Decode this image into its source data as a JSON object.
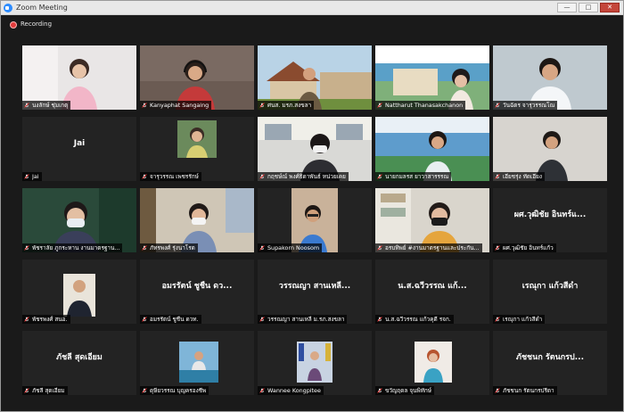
{
  "window": {
    "title": "Zoom Meeting",
    "controls": {
      "minimize": "—",
      "maximize": "□",
      "close": "✕"
    }
  },
  "recording": {
    "label": "Recording"
  },
  "participants": [
    {
      "name": "นงลักษ์ ชุ่มเกตุ",
      "display": "",
      "video": "woman-light"
    },
    {
      "name": "Kanyaphat Sangaing",
      "display": "",
      "video": "woman-headset"
    },
    {
      "name": "ศนส. มรภ.สงขลา",
      "display": "",
      "video": "building-man"
    },
    {
      "name": "Nattharut Thanasakchanon",
      "display": "",
      "video": "banner-woman"
    },
    {
      "name": "วันฉัตร จารุวรรณโณ",
      "display": "",
      "video": "man-smile",
      "active": true
    },
    {
      "name": "Jai",
      "display": "Jai",
      "video": "none"
    },
    {
      "name": "จารุวรรณ เพชรรักษ์",
      "display": "",
      "video": "portrait-small"
    },
    {
      "name": "กฤชษ์ณ์ พงศ์ธิดาพันธ์ หน่วยเคย",
      "display": "",
      "video": "office-woman"
    },
    {
      "name": "นายกมลรส ยาวาสารรรณ",
      "display": "",
      "video": "banner-man"
    },
    {
      "name": "เอี่ยชรุ่ง ทัดเอียง",
      "display": "",
      "video": "man-wall"
    },
    {
      "name": "พัชราลัย ภูกระหาน งานมาตรฐาน...",
      "display": "",
      "video": "woman-mask"
    },
    {
      "name": "ภัทรพงศ์ รุ่งนาโรด",
      "display": "",
      "video": "woman-shelf"
    },
    {
      "name": "Supakorn Noosom",
      "display": "",
      "video": "man-glasses"
    },
    {
      "name": "อรบทิพย์ #งานมาตรฐานและประกัน...",
      "display": "",
      "video": "woman-mask-shelf"
    },
    {
      "name": "ผศ.วุฒิชัย อินทร์แก้ว",
      "display": "ผศ.วุฒิชัย อินทร์แ...",
      "video": "none"
    },
    {
      "name": "พัชรพงศ์ สนอ.",
      "display": "",
      "video": "portrait-suit"
    },
    {
      "name": "อมรรัตน์ ชูชื่น ดวท.",
      "display": "อมรรัตน์ ชูชื่น ดว...",
      "video": "none"
    },
    {
      "name": "วรรณญา สานเหลี่ ม.รภ.สงขลา",
      "display": "วรรณญา สานเหลี่...",
      "video": "none"
    },
    {
      "name": "น.ส.ฉวีวรรณ แก้วคุดี รจก.",
      "display": "น.ส.ฉวีวรรณ แก้...",
      "video": "none"
    },
    {
      "name": "เรณุกา แก้วสีดำ",
      "display": "เรณุกา แก้วสีดำ",
      "video": "none"
    },
    {
      "name": "ภัชลี สุดเอี่ยม",
      "display": "ภัชลี สุดเอี่ยม",
      "video": "none"
    },
    {
      "name": "ดุษียวรรณ บุญครองชีพ",
      "display": "",
      "video": "outdoor-sea"
    },
    {
      "name": "Wannee Kongpitee",
      "display": "",
      "video": "flags-woman"
    },
    {
      "name": "ขวัญฤดล จุนพิทักษ์",
      "display": "",
      "video": "portrait-woman"
    },
    {
      "name": "ภัชชนก รัตนกรปรีดา",
      "display": "ภัชชนก รัตนกรป...",
      "video": "none"
    }
  ]
}
